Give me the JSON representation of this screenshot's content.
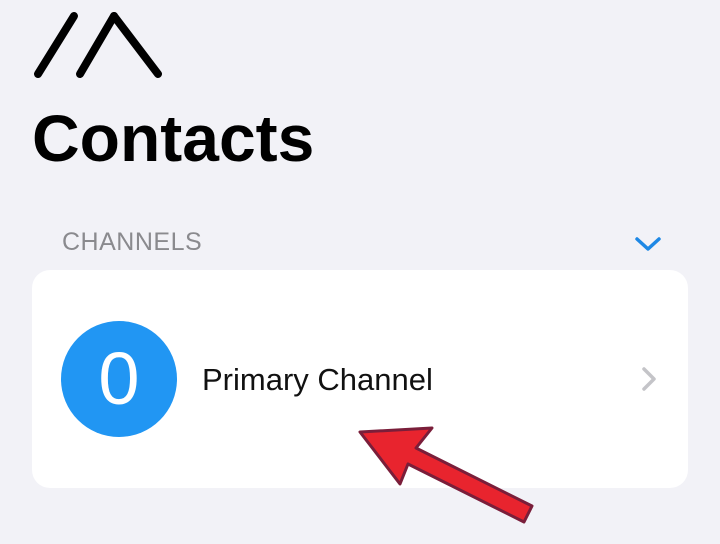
{
  "header": {
    "logo_icon": "mountain-logo-icon",
    "title": "Contacts"
  },
  "section": {
    "title": "CHANNELS",
    "toggle_icon": "chevron-down-icon",
    "accent_color": "#1e88e5"
  },
  "channels": [
    {
      "avatar_label": "0",
      "avatar_color": "#2196f3",
      "name": "Primary Channel",
      "chevron_icon": "chevron-right-icon"
    }
  ],
  "annotation": {
    "icon": "red-arrow-icon",
    "color": "#e8242e"
  }
}
